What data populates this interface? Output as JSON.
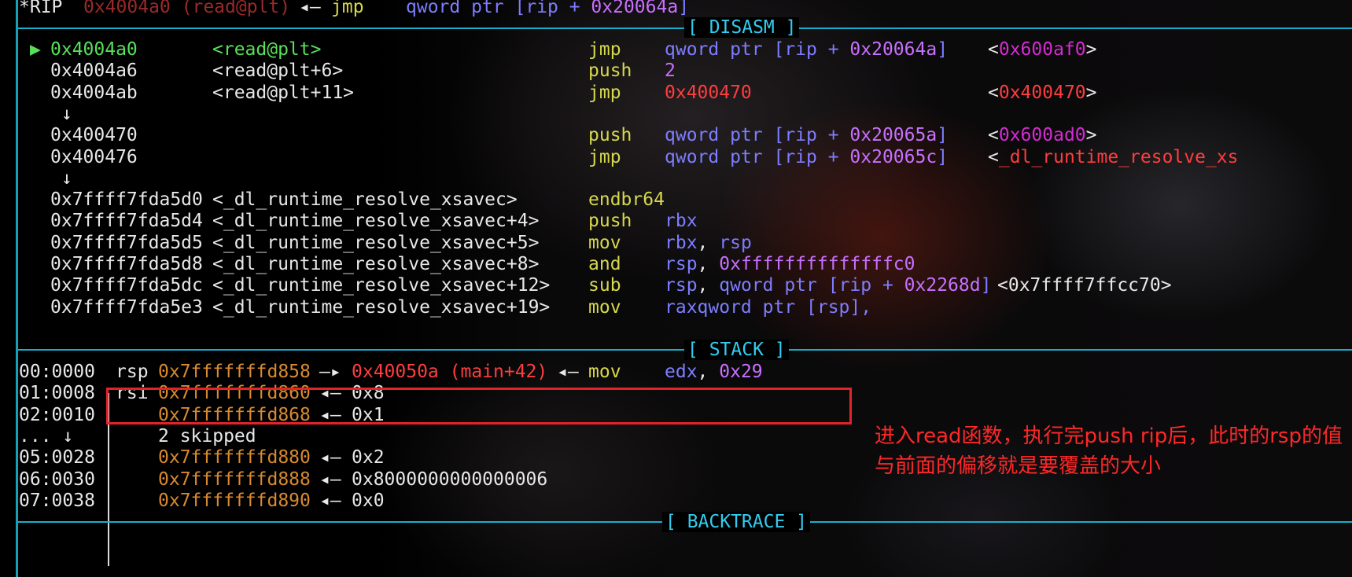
{
  "title": "*RIP  0x4004a0 (read@plt) ◂— jmp    qword ptr [rip + 0x20064a]",
  "header_line": {
    "reg": "*RIP",
    "addr": "0x4004a0 (read@plt)",
    "arrow": "◂—",
    "mnem": "jmp",
    "op_pre": "qword ptr [rip + ",
    "op_hex": "0x20064a",
    "op_post": "]"
  },
  "sections": {
    "disasm": "[ DISASM ]",
    "stack": "[ STACK ]",
    "backtrace": "[ BACKTRACE ]"
  },
  "disasm": [
    {
      "marker": "▶",
      "addr": "0x4004a0",
      "sym": "<read@plt>",
      "mnem": "jmp",
      "op_pre": "qword ptr [rip + ",
      "op_hex": "0x20064a",
      "op_post": "]",
      "t_pre": "<",
      "t_val": "0x600af0",
      "t_post": ">"
    },
    {
      "marker": "",
      "addr": "0x4004a6",
      "sym": "<read@plt+6>",
      "mnem": "push",
      "op_num": "2"
    },
    {
      "marker": "",
      "addr": "0x4004ab",
      "sym": "<read@plt+11>",
      "mnem": "jmp",
      "op_red": "0x400470",
      "t_pre": "<",
      "t_val": "0x400470",
      "t_post": ">"
    },
    {
      "arrow": "↓"
    },
    {
      "marker": "",
      "addr": "0x400470",
      "sym": "",
      "mnem": "push",
      "op_pre": "qword ptr [rip + ",
      "op_hex": "0x20065a",
      "op_post": "]",
      "t_pre": "<",
      "t_val": "0x600ad0",
      "t_post": ">"
    },
    {
      "marker": "",
      "addr": "0x400476",
      "sym": "",
      "mnem": "jmp",
      "op_pre": "qword ptr [rip + ",
      "op_hex": "0x20065c",
      "op_post": "]",
      "t_pre": "<",
      "t_val": "_dl_runtime_resolve_xs",
      "t_post": ""
    },
    {
      "arrow": "↓"
    },
    {
      "marker": "",
      "addr": "0x7ffff7fda5d0",
      "sym": "<_dl_runtime_resolve_xsavec>",
      "mnem": "endbr64"
    },
    {
      "marker": "",
      "addr": "0x7ffff7fda5d4",
      "sym": "<_dl_runtime_resolve_xsavec+4>",
      "mnem": "push",
      "op_reg": "rbx"
    },
    {
      "marker": "",
      "addr": "0x7ffff7fda5d5",
      "sym": "<_dl_runtime_resolve_xsavec+5>",
      "mnem": "mov",
      "op_reg": "rbx",
      "op_sep": ", ",
      "op_reg2": "rsp"
    },
    {
      "marker": "",
      "addr": "0x7ffff7fda5d8",
      "sym": "<_dl_runtime_resolve_xsavec+8>",
      "mnem": "and",
      "op_reg": "rsp",
      "op_sep": ", ",
      "op_num2": "0xffffffffffffffc0"
    },
    {
      "marker": "",
      "addr": "0x7ffff7fda5dc",
      "sym": "<_dl_runtime_resolve_xsavec+12>",
      "mnem": "sub",
      "op_reg": "rsp",
      "op_sep": ", ",
      "op_pre": "qword ptr [rip + ",
      "op_hex": "0x2268d",
      "op_post": "]",
      "t_plain": "<0x7ffff7ffcc70>"
    },
    {
      "marker": "",
      "addr": "0x7ffff7fda5e3",
      "sym": "<_dl_runtime_resolve_xsavec+19>",
      "mnem": "mov",
      "op_pre": "qword ptr [rsp], ",
      "op_reg": "rax"
    }
  ],
  "stack": [
    {
      "idx": "00:0000",
      "reg": "rsp",
      "addr": "0x7fffffffd858",
      "arrow": "—▸",
      "val": "0x40050a (main+42)",
      "tail_arrow": "◂—",
      "mnem": "mov",
      "op_reg": "edx",
      "op_sep": ", ",
      "op_num": "0x29"
    },
    {
      "idx": "01:0008",
      "reg": "rsi",
      "addr": "0x7fffffffd860",
      "arrow": "◂—",
      "val": "0x8"
    },
    {
      "idx": "02:0010",
      "reg": "",
      "addr": "0x7fffffffd868",
      "arrow": "◂—",
      "val": "0x1"
    },
    {
      "idx": "... ↓",
      "skipped": "2 skipped"
    },
    {
      "idx": "05:0028",
      "reg": "",
      "addr": "0x7fffffffd880",
      "arrow": "◂—",
      "val": "0x2"
    },
    {
      "idx": "06:0030",
      "reg": "",
      "addr": "0x7fffffffd888",
      "arrow": "◂—",
      "val": "0x8000000000000006"
    },
    {
      "idx": "07:0038",
      "reg": "",
      "addr": "0x7fffffffd890",
      "arrow": "◂—",
      "val": "0x0"
    }
  ],
  "annotation": "进入read函数，执行完push rip后，此时的rsp的值与前面的偏移就是要覆盖的大小",
  "colors": {
    "section_line": "#17b0cc",
    "highlight_box": "#e0242b",
    "annotation_text": "#ff2828"
  }
}
